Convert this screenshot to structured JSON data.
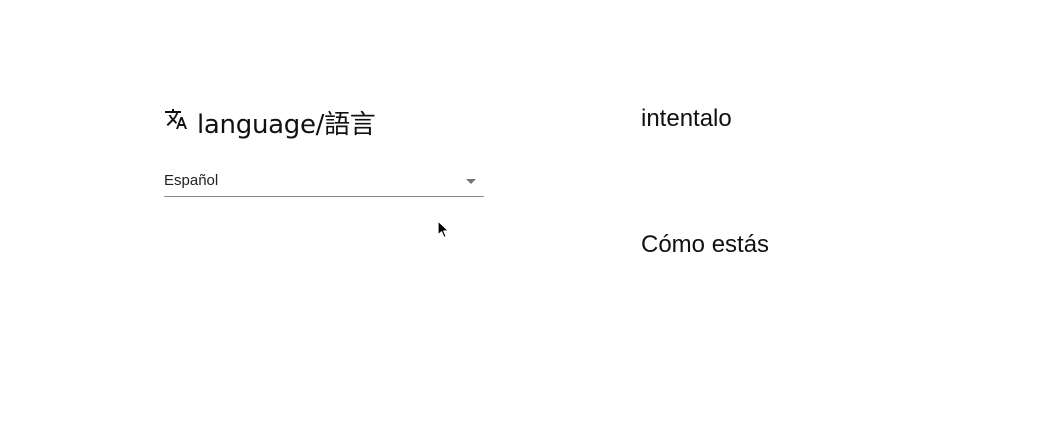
{
  "language_section": {
    "icon": "translate-icon",
    "title": "language/語言"
  },
  "language_select": {
    "selected": "Español"
  },
  "translated": {
    "line1": "intentalo",
    "line2": "Cómo estás"
  }
}
